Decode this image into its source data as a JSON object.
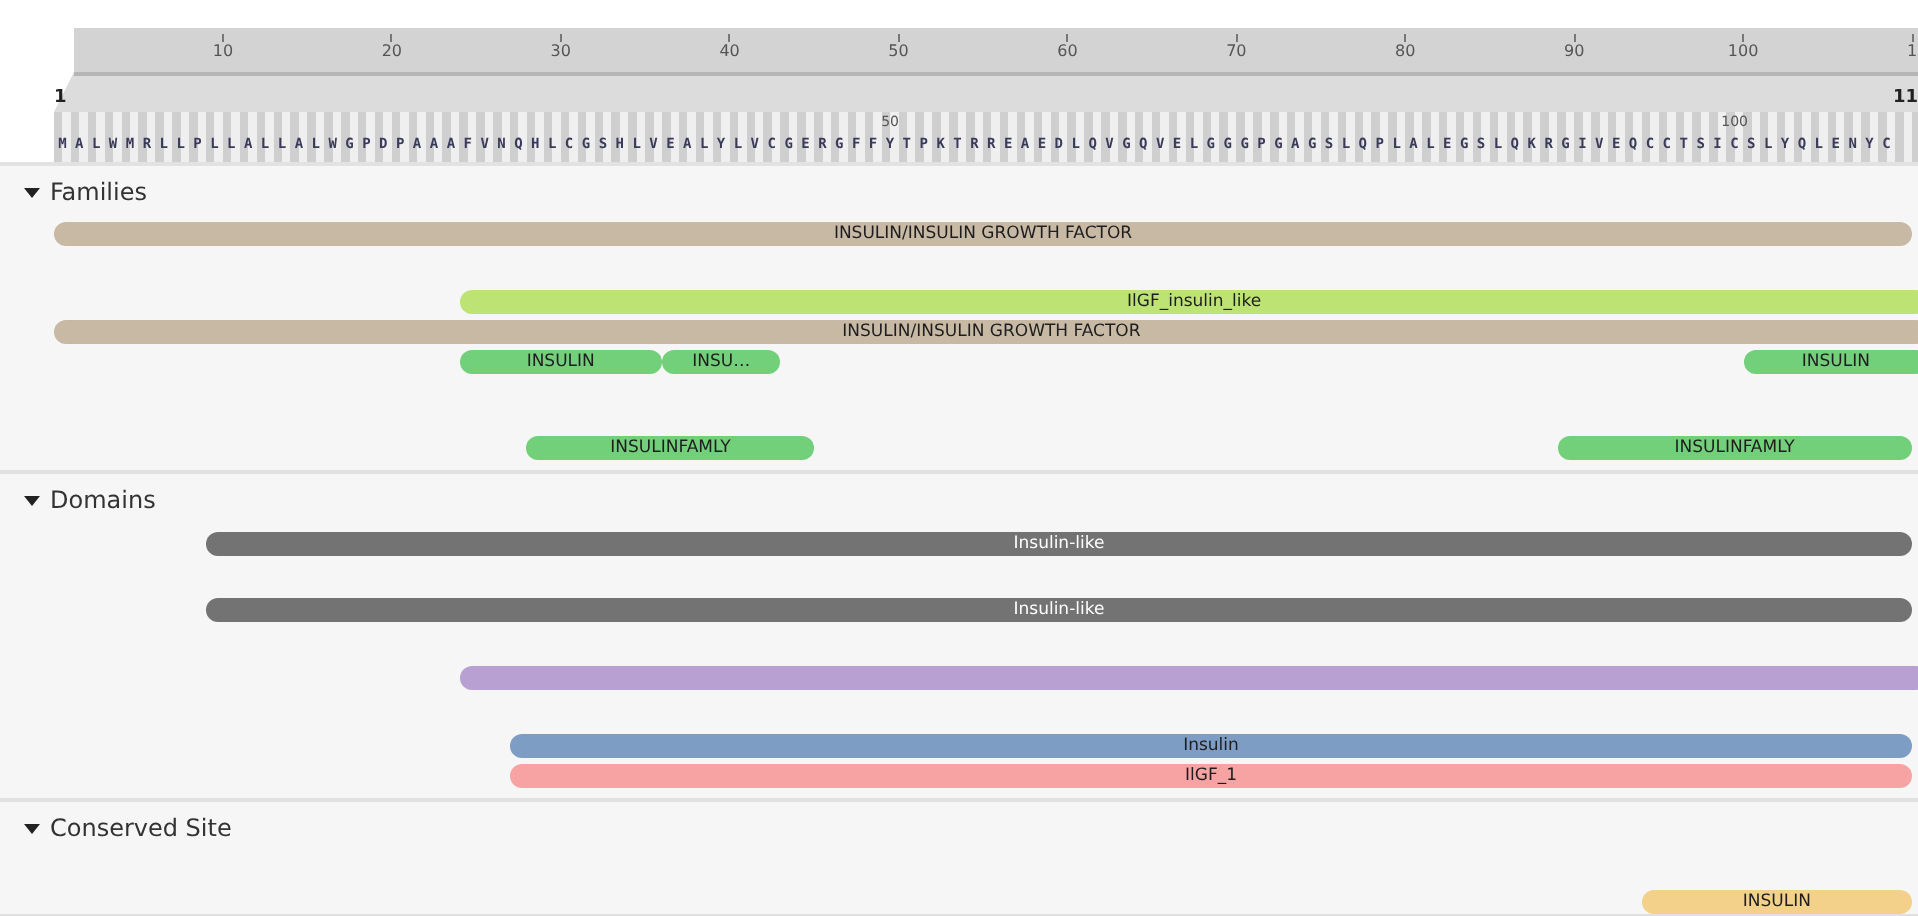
{
  "ruler": {
    "ticks": [
      "10",
      "20",
      "30",
      "40",
      "50",
      "60",
      "70",
      "80",
      "90",
      "100",
      "1"
    ]
  },
  "sequence": {
    "start_label": "1",
    "end_label": "11",
    "residues": "MALWMRLLPLLALLALWGPDPAAAFVNQHLCGSHLVEALYLVCGERGFFYTPKTRREAEDLQVGQVELGGGPGAGSLQPLALEGSLQKRGIVEQCCTSICSLYQLENYC",
    "marks": [
      "50",
      "100"
    ]
  },
  "sections": [
    {
      "title": "Families",
      "expanded": true,
      "features": [
        {
          "label": "INSULIN/INSULIN GROWTH FACTOR",
          "color": "#c8b9a5"
        },
        {
          "label": "IlGF_insulin_like",
          "color": "#bde374"
        },
        {
          "label": "INSULIN/INSULIN GROWTH FACTOR",
          "color": "#c8b9a5"
        },
        {
          "label": "INSULIN",
          "color": "#72cf7a"
        },
        {
          "label": "INSU…",
          "color": "#72cf7a"
        },
        {
          "label": "INSULIN",
          "color": "#72cf7a"
        },
        {
          "label": "INSULINFAMLY",
          "color": "#72cf7a"
        },
        {
          "label": "INSULINFAMLY",
          "color": "#72cf7a"
        }
      ]
    },
    {
      "title": "Domains",
      "expanded": true,
      "features": [
        {
          "label": "Insulin-like",
          "color": "#737373"
        },
        {
          "label": "Insulin-like",
          "color": "#737373"
        },
        {
          "color": "#b9a0d2"
        },
        {
          "label": "Insulin",
          "color": "#7d9dc5"
        },
        {
          "label": "IlGF_1",
          "color": "#f8a3a3"
        }
      ]
    },
    {
      "title": "Conserved Site",
      "expanded": true,
      "features": [
        {
          "label": "INSULIN",
          "color": "#f4d18b"
        }
      ]
    }
  ]
}
